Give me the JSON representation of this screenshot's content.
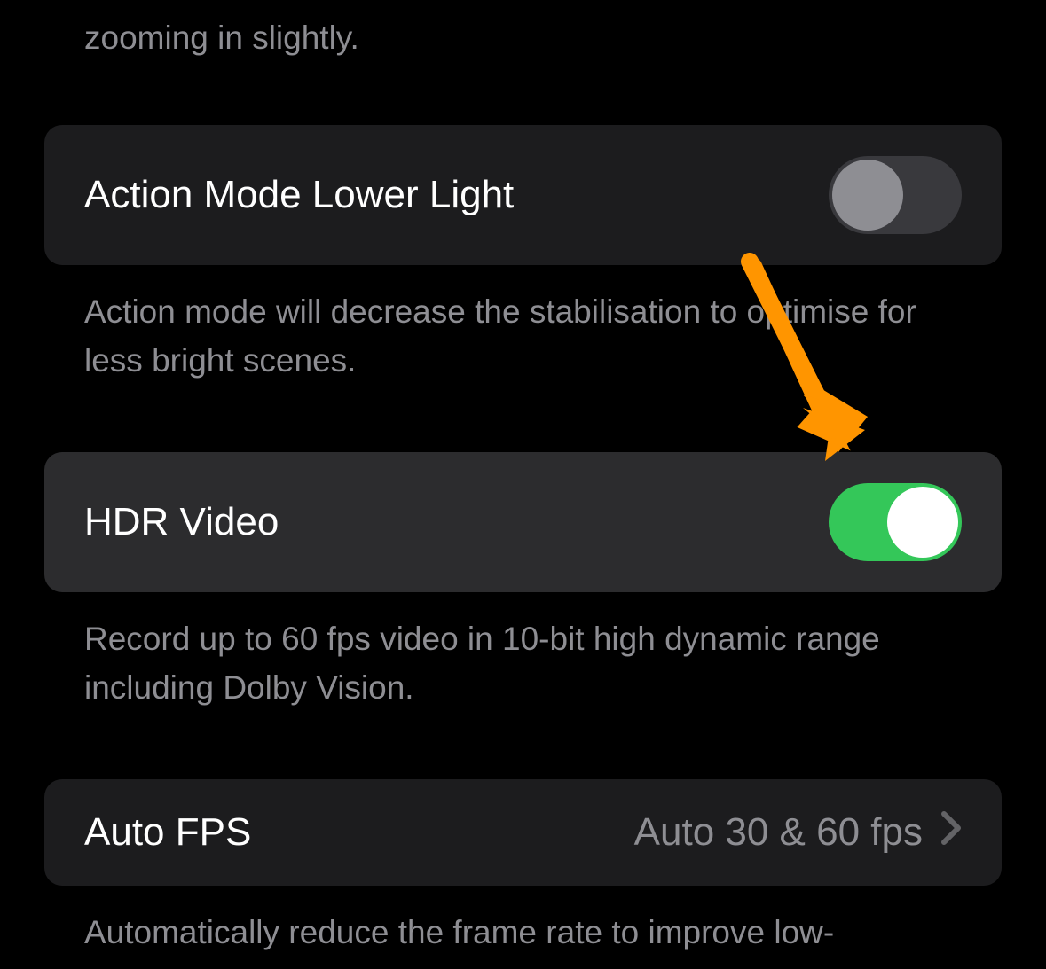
{
  "top_description": "zooming in slightly.",
  "settings": {
    "action_mode": {
      "label": "Action Mode Lower Light",
      "enabled": false,
      "description": "Action mode will decrease the stabilisation to optimise for less bright scenes."
    },
    "hdr_video": {
      "label": "HDR Video",
      "enabled": true,
      "description": "Record up to 60 fps video in 10-bit high dynamic range including Dolby Vision."
    },
    "auto_fps": {
      "label": "Auto FPS",
      "value": "Auto 30 & 60 fps",
      "description": "Automatically reduce the frame rate to improve low-"
    }
  },
  "colors": {
    "toggle_on": "#34c759",
    "toggle_off": "#39393d",
    "row_bg": "#1c1c1e",
    "row_highlight": "#2c2c2e",
    "text_secondary": "#8e8e93",
    "annotation_arrow": "#ff9500"
  }
}
